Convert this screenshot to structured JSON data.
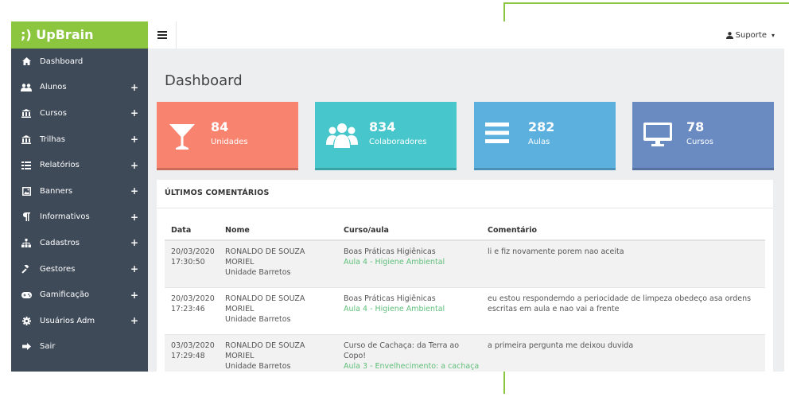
{
  "brand": {
    "name": ";) UpBrain"
  },
  "sidebar": {
    "items": [
      {
        "label": "Dashboard",
        "icon": "home-icon",
        "expandable": false
      },
      {
        "label": "Alunos",
        "icon": "users-icon",
        "expandable": true
      },
      {
        "label": "Cursos",
        "icon": "institution-icon",
        "expandable": true
      },
      {
        "label": "Trilhas",
        "icon": "institution-icon",
        "expandable": true
      },
      {
        "label": "Relatórios",
        "icon": "report-icon",
        "expandable": true
      },
      {
        "label": "Banners",
        "icon": "image-icon",
        "expandable": true
      },
      {
        "label": "Informativos",
        "icon": "paragraph-icon",
        "expandable": true
      },
      {
        "label": "Cadastros",
        "icon": "sitemap-icon",
        "expandable": true
      },
      {
        "label": "Gestores",
        "icon": "gavel-icon",
        "expandable": true
      },
      {
        "label": "Gamificação",
        "icon": "gamepad-icon",
        "expandable": true
      },
      {
        "label": "Usuários Adm",
        "icon": "gear-icon",
        "expandable": true
      },
      {
        "label": "Sair",
        "icon": "sign-out-icon",
        "expandable": false
      }
    ],
    "plus_symbol": "+"
  },
  "topbar": {
    "user_label": "Suporte",
    "caret": "▾"
  },
  "page": {
    "title": "Dashboard"
  },
  "stats": [
    {
      "value": "84",
      "label": "Unidades",
      "color": "#f8836f",
      "icon": "glass-icon"
    },
    {
      "value": "834",
      "label": "Colaboradores",
      "color": "#47c7cb",
      "icon": "group-icon"
    },
    {
      "value": "282",
      "label": "Aulas",
      "color": "#5cb0de",
      "icon": "bars-icon"
    },
    {
      "value": "78",
      "label": "Cursos",
      "color": "#6a8ac2",
      "icon": "monitor-icon"
    }
  ],
  "comments": {
    "title": "ÚLTIMOS COMENTÁRIOS",
    "columns": [
      "Data",
      "Nome",
      "Curso/aula",
      "Comentário"
    ],
    "rows": [
      {
        "date": "20/03/2020",
        "time": "17:30:50",
        "name1": "RONALDO DE SOUZA",
        "name2": "MORIEL",
        "unit": "Unidade Barretos",
        "course1": "Boas Práticas Higiênicas",
        "course2": "",
        "lesson": "Aula 4 - Higiene Ambiental",
        "comment": "li e fiz novamente porem nao aceita"
      },
      {
        "date": "20/03/2020",
        "time": "17:23:46",
        "name1": "RONALDO DE SOUZA",
        "name2": "MORIEL",
        "unit": "Unidade Barretos",
        "course1": "Boas Práticas Higiênicas",
        "course2": "",
        "lesson": "Aula 4 - Higiene Ambiental",
        "comment": "eu estou respondemdo a periocidade de limpeza obedeço asa ordens escritas em aula e nao vai a frente"
      },
      {
        "date": "03/03/2020",
        "time": "17:29:48",
        "name1": "RONALDO DE SOUZA",
        "name2": "MORIEL",
        "unit": "Unidade Barretos",
        "course1": "Curso de Cachaça: da Terra ao",
        "course2": "Copo!",
        "lesson": "Aula 3 - Envelhecimento: a cachaça",
        "comment": "a primeira pergunta me deixou duvida"
      }
    ]
  },
  "colors": {
    "brand": "#8cc63f",
    "sidebar": "#3f4a59",
    "lesson_link": "#5fbf7a"
  }
}
